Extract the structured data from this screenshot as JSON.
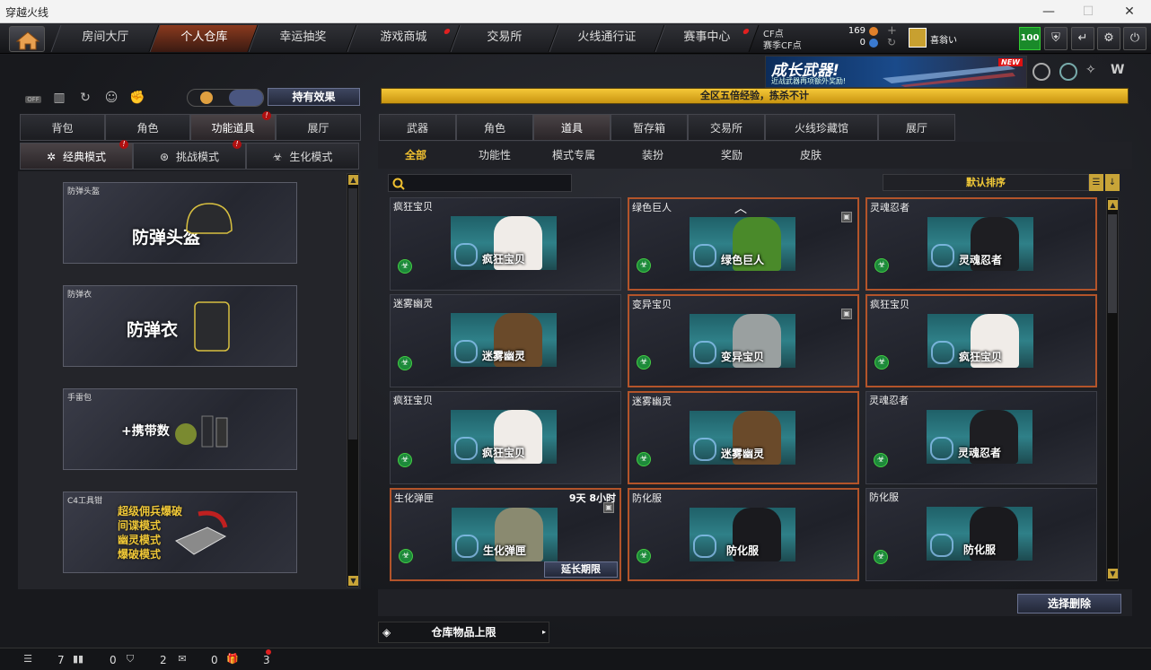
{
  "window": {
    "title": "穿越火线",
    "minimize": "—",
    "maximize": "☐",
    "close": "✕"
  },
  "nav": {
    "tabs": [
      {
        "label": "房间大厅"
      },
      {
        "label": "个人仓库"
      },
      {
        "label": "幸运抽奖"
      },
      {
        "label": "游戏商城"
      },
      {
        "label": "交易所"
      },
      {
        "label": "火线通行证"
      },
      {
        "label": "赛事中心"
      }
    ],
    "active_tab": "个人仓库",
    "cf_label": "CF点",
    "cf_value": "169",
    "season_cf_label": "赛季CF点",
    "season_cf_value": "0",
    "username": "喜翁い",
    "level": "100"
  },
  "banner": {
    "title": "成长武器!",
    "subtitle": "近战武器再项额外奖励!",
    "badge": "NEW"
  },
  "notice": "全区五倍经验，拣杀不计",
  "left": {
    "toggle_off": "OFF",
    "effect_button": "持有效果",
    "tabs": [
      {
        "label": "背包"
      },
      {
        "label": "角色"
      },
      {
        "label": "功能道具"
      },
      {
        "label": "展厅"
      }
    ],
    "active_tab": "功能道具",
    "modes": [
      {
        "label": "经典模式"
      },
      {
        "label": "挑战模式"
      },
      {
        "label": "生化模式"
      }
    ],
    "equip": [
      {
        "label": "防弹头盔",
        "big": "防弹头盔"
      },
      {
        "label": "防弹衣",
        "big": "防弹衣"
      },
      {
        "label": "手雷包",
        "big": "+携带数"
      },
      {
        "label": "C4工具钳",
        "big_lines": [
          "超级佣兵爆破",
          "间谍模式",
          "幽灵模式",
          "爆破模式"
        ]
      }
    ]
  },
  "right": {
    "tabs": [
      {
        "label": "武器"
      },
      {
        "label": "角色"
      },
      {
        "label": "道具"
      },
      {
        "label": "暂存箱"
      },
      {
        "label": "交易所"
      },
      {
        "label": "火线珍藏馆"
      },
      {
        "label": "展厅"
      }
    ],
    "active_tab": "道具",
    "subtabs": [
      {
        "label": "全部"
      },
      {
        "label": "功能性"
      },
      {
        "label": "模式专属"
      },
      {
        "label": "装扮"
      },
      {
        "label": "奖励"
      },
      {
        "label": "皮肤"
      }
    ],
    "active_subtab": "全部",
    "search_placeholder": "",
    "sort_label": "默认排序",
    "items": [
      {
        "name": "疯狂宝贝",
        "thumb": "疯狂宝贝",
        "selected": false,
        "locked": false
      },
      {
        "name": "绿色巨人",
        "thumb": "绿色巨人",
        "selected": true,
        "locked": true
      },
      {
        "name": "灵魂忍者",
        "thumb": "灵魂忍者",
        "selected": true,
        "locked": false
      },
      {
        "name": "迷雾幽灵",
        "thumb": "迷雾幽灵",
        "selected": false,
        "locked": false
      },
      {
        "name": "变异宝贝",
        "thumb": "变异宝贝",
        "selected": true,
        "locked": true
      },
      {
        "name": "疯狂宝贝",
        "thumb": "疯狂宝贝",
        "selected": true,
        "locked": false
      },
      {
        "name": "疯狂宝贝",
        "thumb": "疯狂宝贝",
        "selected": false,
        "locked": false
      },
      {
        "name": "迷雾幽灵",
        "thumb": "迷雾幽灵",
        "selected": true,
        "locked": false
      },
      {
        "name": "灵魂忍者",
        "thumb": "灵魂忍者",
        "selected": false,
        "locked": false
      },
      {
        "name": "生化弹匣",
        "thumb": "生化弹匣",
        "selected": true,
        "locked": true,
        "time": "9天 8小时",
        "extend": "延长期限"
      },
      {
        "name": "防化服",
        "thumb": "防化服",
        "selected": true,
        "locked": false
      },
      {
        "name": "防化服",
        "thumb": "防化服",
        "selected": false,
        "locked": false
      }
    ],
    "delete_button": "选择删除",
    "storage_limit": "仓库物品上限"
  },
  "status": {
    "count1": "7",
    "count2": "0",
    "count3": "2",
    "count4": "0",
    "count5": "3"
  }
}
